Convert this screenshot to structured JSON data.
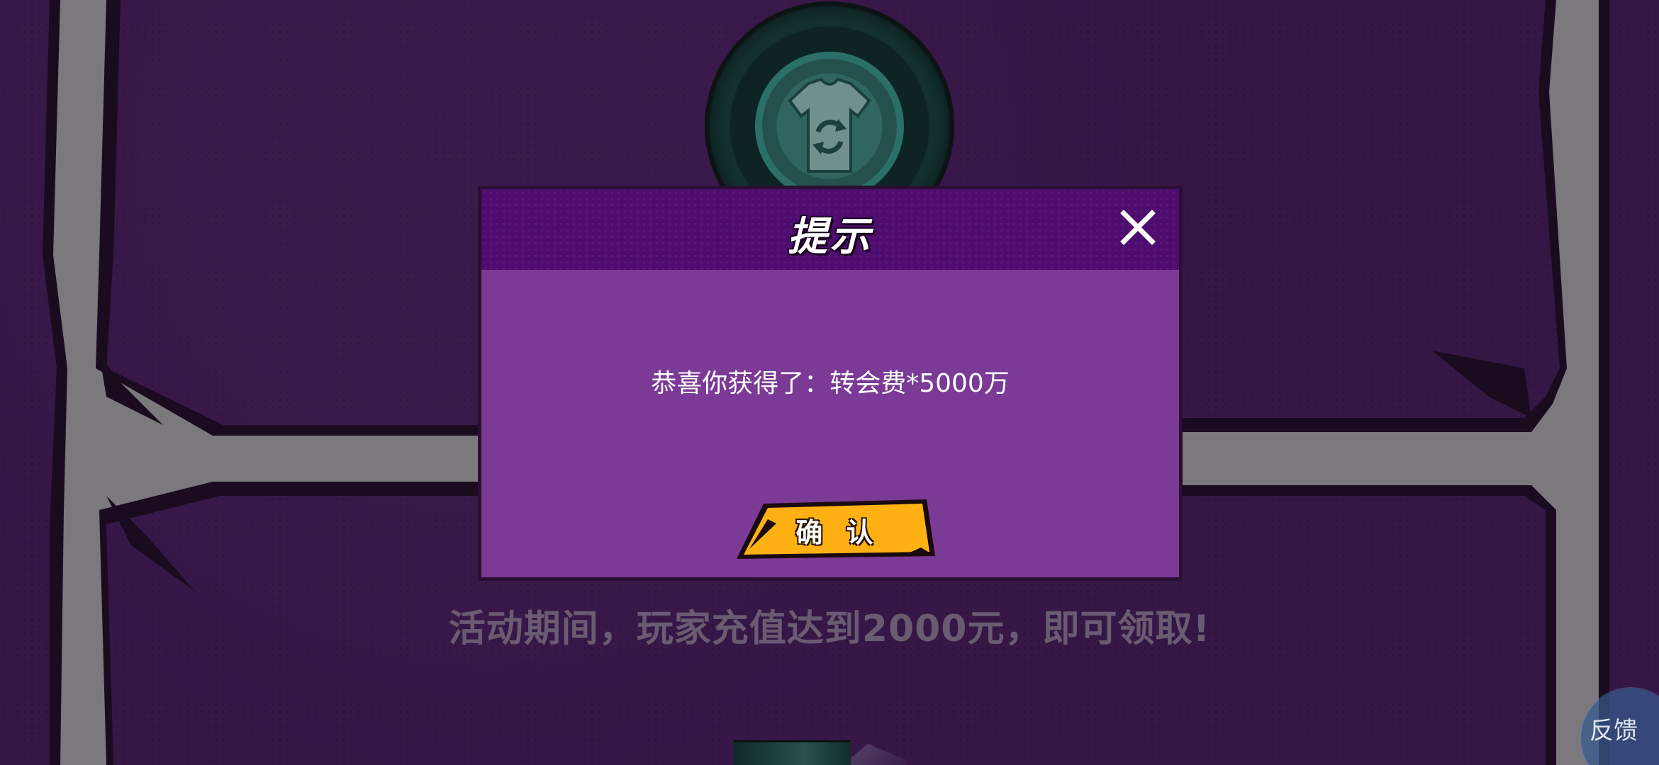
{
  "background": {
    "activity_text": "活动期间，玩家充值达到2000元，即可领取!",
    "medal_icon": "jersey-transfer-icon"
  },
  "modal": {
    "title": "提示",
    "message": "恭喜你获得了：转会费*5000万",
    "confirm_label": "确 认",
    "close_icon": "close-icon"
  },
  "feedback_button": {
    "label": "反馈"
  },
  "colors": {
    "background": "#3b1a4d",
    "modal_body": "#7a3a96",
    "modal_header": "#4e0d6e",
    "confirm_button": "#ffb114",
    "frame_gray": "#8e8c90"
  }
}
